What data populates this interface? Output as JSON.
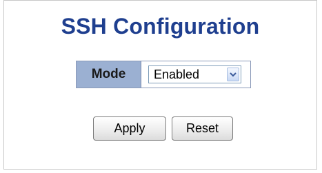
{
  "page": {
    "title": "SSH Configuration"
  },
  "form": {
    "mode_label": "Mode",
    "mode_value": "Enabled",
    "mode_options_visible": [
      "Enabled"
    ]
  },
  "buttons": {
    "apply_label": "Apply",
    "reset_label": "Reset"
  },
  "colors": {
    "title": "#1f3f8f",
    "label_cell_bg": "#9bb0d2",
    "panel_border": "#c8c8c8"
  },
  "icons": {
    "dropdown": "chevron-down-icon"
  }
}
